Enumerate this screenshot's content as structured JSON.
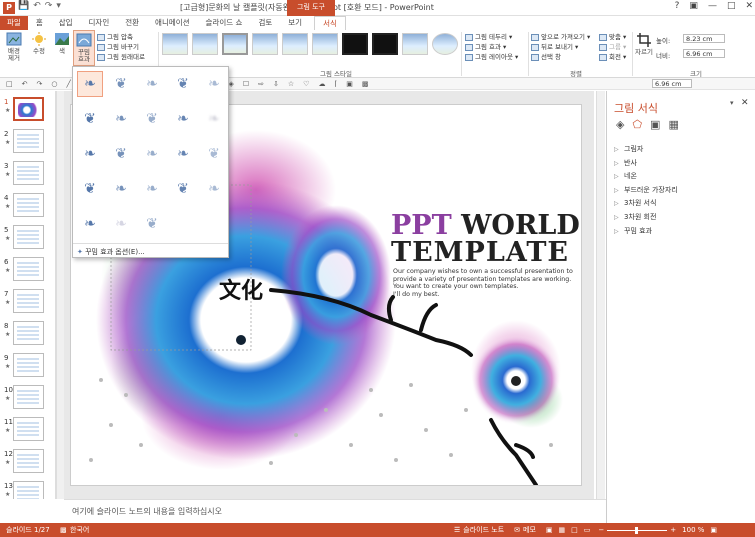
{
  "window": {
    "app_badge": "P",
    "title": "[고급형]문화의 날 캘플릿(자동완성형 포함).ppt [호환 모드] - PowerPoint",
    "context_group": "그림 도구"
  },
  "tabs": [
    "파일",
    "홈",
    "삽입",
    "디자인",
    "전환",
    "애니메이션",
    "슬라이드 쇼",
    "검토",
    "보기",
    "서식"
  ],
  "ribbon": {
    "remove_bg": "배경\n제거",
    "corrections": "수정",
    "color": "색",
    "artistic_effects": "꾸밈\n효과",
    "compress": "그림 압축",
    "change": "그림 바꾸기",
    "reset": "그림 원래대로",
    "picture_styles_label": "그림 스타일",
    "border": "그림 테두리",
    "effects": "그림 효과",
    "layout": "그림 레이아웃",
    "bring_forward": "앞으로 가져오기",
    "send_backward": "뒤로 보내기",
    "selection_pane": "선택 창",
    "align": "맞춤",
    "group": "그룹",
    "rotate": "회전",
    "arrange_label": "정렬",
    "crop": "자르기",
    "height_label": "높이:",
    "height_value": "8.23 cm",
    "width_label": "너비:",
    "width_value": "6.96 cm",
    "size_label": "크기",
    "toolbar_size_value": "6.96 cm"
  },
  "dropdown": {
    "footer": "꾸밈 효과 옵션(E)..."
  },
  "slides": [
    {
      "num": "1"
    },
    {
      "num": "2"
    },
    {
      "num": "3"
    },
    {
      "num": "4"
    },
    {
      "num": "5"
    },
    {
      "num": "6"
    },
    {
      "num": "7"
    },
    {
      "num": "8"
    },
    {
      "num": "9"
    },
    {
      "num": "10"
    },
    {
      "num": "11"
    },
    {
      "num": "12"
    },
    {
      "num": "13"
    }
  ],
  "slide": {
    "title_ppt": "PPT",
    "title_world": " WORLD",
    "title_template": "TEMPLATE",
    "calligraphy": "文化",
    "body": [
      "Our company wishes to own a successful presentation to",
      "provide a variety of presentation templates are working.",
      "You want to create your own templates.",
      "I'll do my best."
    ]
  },
  "notes": "여기에 슬라이드 노트의 내용을 입력하십시오",
  "pane": {
    "title": "그림 서식",
    "items": [
      "그림자",
      "반사",
      "네온",
      "부드러운 가장자리",
      "3차원 서식",
      "3차원 회전",
      "꾸밈 효과"
    ]
  },
  "status": {
    "slide_info": "슬라이드 1/27",
    "language": "한국어",
    "notes_btn": "슬라이드 노트",
    "comments_btn": "메모",
    "zoom": "100 %"
  },
  "colors": {
    "accent": "#c84d2c",
    "ppt_p1": "#8b3fa0",
    "ppt_p2": "#6a4fb0",
    "ppt_t": "#2a9a5a"
  }
}
